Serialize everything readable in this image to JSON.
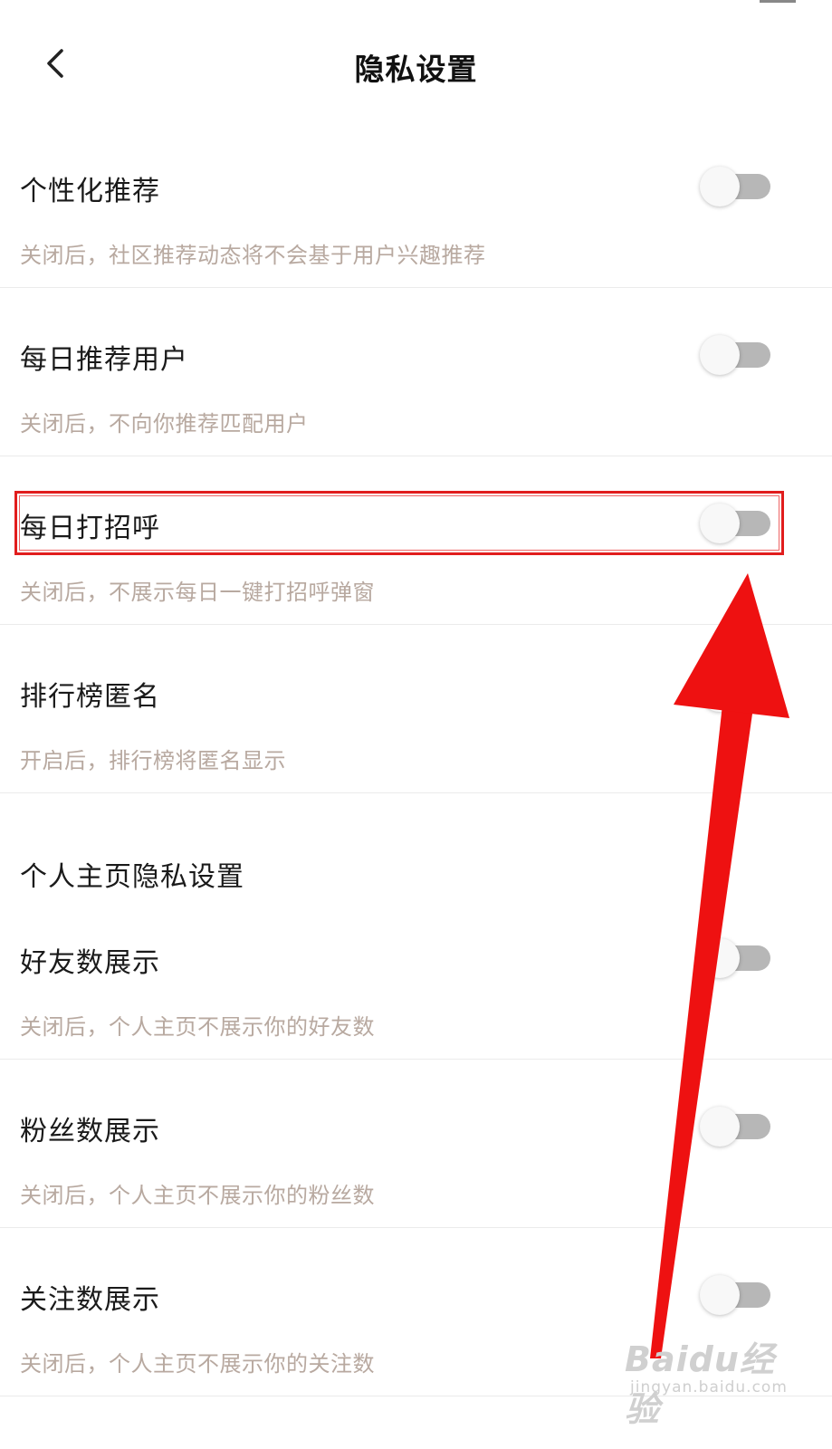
{
  "header": {
    "title": "隐私设置",
    "back_icon": "chevron-left-icon"
  },
  "settings": [
    {
      "label": "个性化推荐",
      "desc": "关闭后，社区推荐动态将不会基于用户兴趣推荐",
      "enabled": false
    },
    {
      "label": "每日推荐用户",
      "desc": "关闭后，不向你推荐匹配用户",
      "enabled": false
    },
    {
      "label": "每日打招呼",
      "desc": "关闭后，不展示每日一键打招呼弹窗",
      "enabled": false
    },
    {
      "label": "排行榜匿名",
      "desc": "开启后，排行榜将匿名显示",
      "enabled": false
    }
  ],
  "profile_section": {
    "heading": "个人主页隐私设置",
    "items": [
      {
        "label": "好友数展示",
        "desc": "关闭后，个人主页不展示你的好友数",
        "enabled": false
      },
      {
        "label": "粉丝数展示",
        "desc": "关闭后，个人主页不展示你的粉丝数",
        "enabled": false
      },
      {
        "label": "关注数展示",
        "desc": "关闭后，个人主页不展示你的关注数",
        "enabled": false
      }
    ]
  },
  "annotation": {
    "highlight_color": "#e11d1d",
    "arrow_color": "#ee1111"
  },
  "watermark": {
    "logo": "Baidu经验",
    "url": "jingyan.baidu.com"
  }
}
